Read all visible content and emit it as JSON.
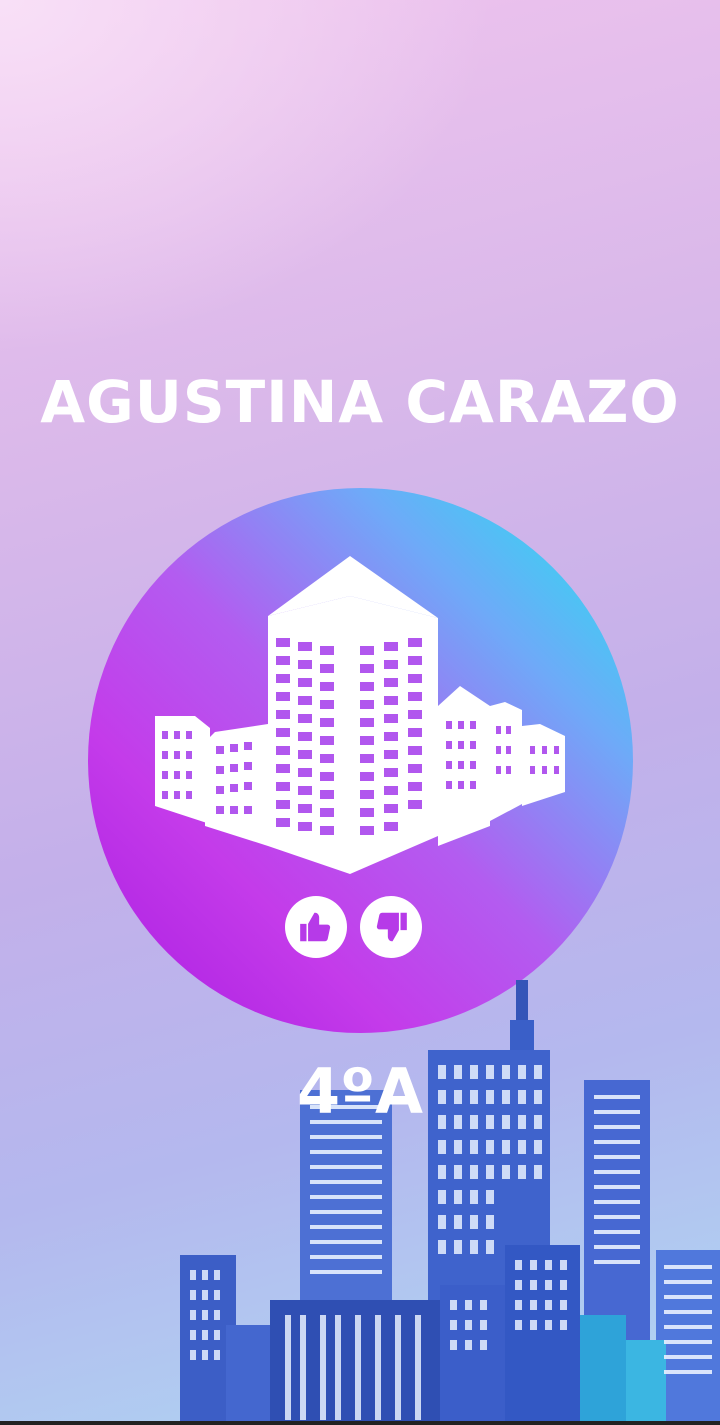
{
  "profile": {
    "name": "AGUSTINA CARAZO",
    "room": "4ºA"
  },
  "icons": {
    "center": "buildings-icon",
    "like": "thumbs-up-icon",
    "dislike": "thumbs-down-icon"
  },
  "colors": {
    "text": "#ffffff",
    "circle_start": "#a81be0",
    "circle_end": "#1fe6ef",
    "skyline": "#3a5fc8"
  }
}
